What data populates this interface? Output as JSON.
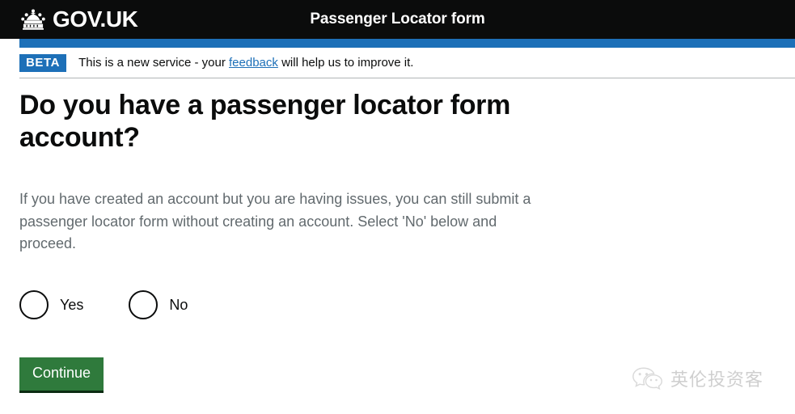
{
  "header": {
    "logo_text": "GOV.UK",
    "crown_icon": "crown-icon",
    "service_name": "Passenger Locator form"
  },
  "phase_banner": {
    "tag": "BETA",
    "text_before": "This is a new service - your ",
    "link_text": "feedback",
    "text_after": " will help us to improve it."
  },
  "main": {
    "heading": "Do you have a passenger locator form account?",
    "body": "If you have created an account but you are having issues, you can still submit a passenger locator form without creating an account. Select 'No' below and proceed.",
    "radios": [
      {
        "label": "Yes",
        "value": "yes",
        "selected": false
      },
      {
        "label": "No",
        "value": "no",
        "selected": false
      }
    ],
    "continue_label": "Continue"
  },
  "watermark": {
    "icon": "wechat-icon",
    "text": "英伦投资客"
  },
  "colors": {
    "header_black": "#0b0c0c",
    "govuk_blue": "#1d70b8",
    "button_green": "#2f7a3c",
    "button_green_shadow": "#0b2b12",
    "body_grey": "#626a6e",
    "divider_grey": "#b1b4b6"
  }
}
